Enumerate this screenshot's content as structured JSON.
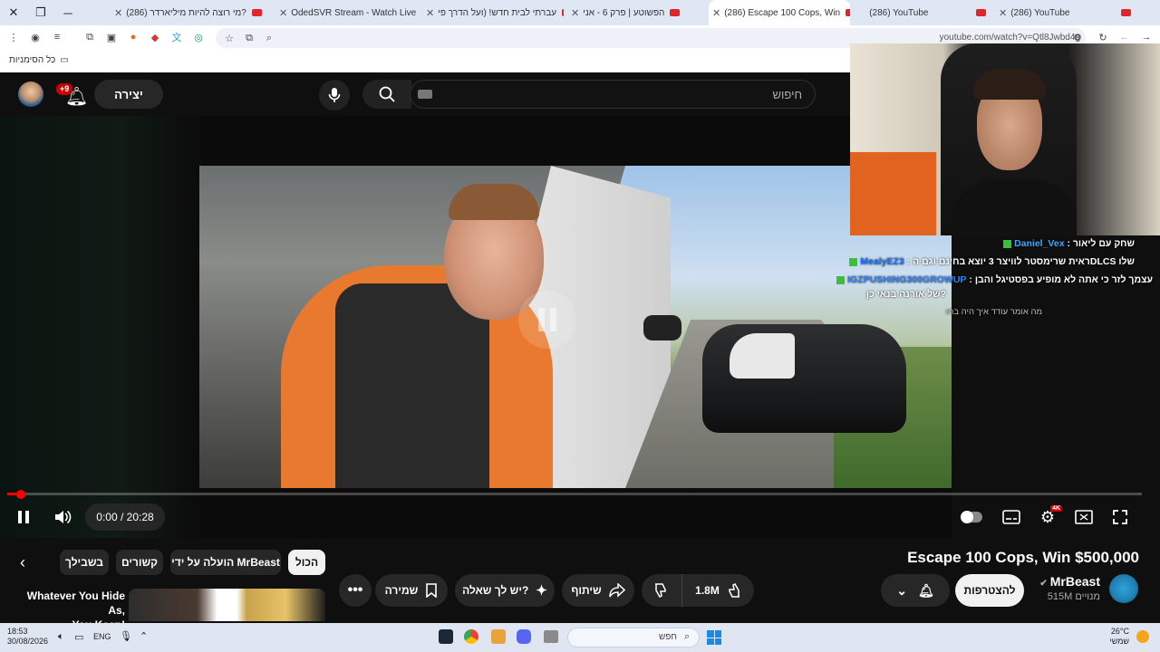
{
  "browser": {
    "tabs": [
      {
        "label": "(286) מי רוצה להיות מיליארדר?"
      },
      {
        "label": "OdedSVR Stream - Watch Live"
      },
      {
        "label": "עברתי לבית חדש! (ועל הדרך פי"
      },
      {
        "label": "הפשוטע | פרק 6 - אני"
      },
      {
        "label": "(286) Escape 100 Cops, Win"
      },
      {
        "label": "(286) YouTube"
      },
      {
        "label": "(286) YouTube"
      }
    ],
    "url": "youtube.com/watch?v=Qtl8Jwbd4g",
    "bookmarks_label": "כל הסימניות"
  },
  "youtube": {
    "search_placeholder": "חיפוש",
    "create_label": "יצירה",
    "notifications_count": "+9",
    "video": {
      "time": "0:00 / 20:28",
      "progress_fraction": 0.012,
      "title": "Escape 100 Cops, Win $500,000"
    },
    "channel": {
      "name": "MrBeast",
      "subscribers": "515M מנויים",
      "subscribe_label": "להצטרפות"
    },
    "actions": {
      "likes": "1.8M",
      "share": "שיתוף",
      "ask": "יש לך שאלה?",
      "save": "שמירה"
    },
    "chips": [
      "הכול",
      "הועלה על ידי MrBeast",
      "קשורים",
      "בשבילך"
    ],
    "rec": {
      "title_line1": "Whatever You Hide As,",
      "title_line2": "You Keep!"
    }
  },
  "stream": {
    "chat": [
      {
        "user": "Daniel_Vex",
        "text": "שחק עם ליאור",
        "user_color": "#3ea6ff"
      },
      {
        "user": "MealyEZ3",
        "text": "שלו DLCSראית שרימסטר לוויצר 3 יוצא בחינם וגם ה",
        "user_color": "#1e78ff"
      },
      {
        "user": "IGZPUSHING300GROWUP",
        "text": "עצמך לזר כי אתה לא מופיע בפסטיגל והבן",
        "user_color": "#2f86ff"
      },
      {
        "user": "",
        "text": "?של אורנה בנאי כן",
        "user_color": "#ffffff"
      },
      {
        "user": "",
        "text": "מה אומר עודד איך היה בחו",
        "user_color": "#bbbbbb"
      }
    ]
  },
  "taskbar": {
    "time": "18:53",
    "date": "30/08/2026",
    "lang": "ENG",
    "search_label": "חפש",
    "weather_temp": "26°C",
    "weather_desc": "שמשי"
  }
}
